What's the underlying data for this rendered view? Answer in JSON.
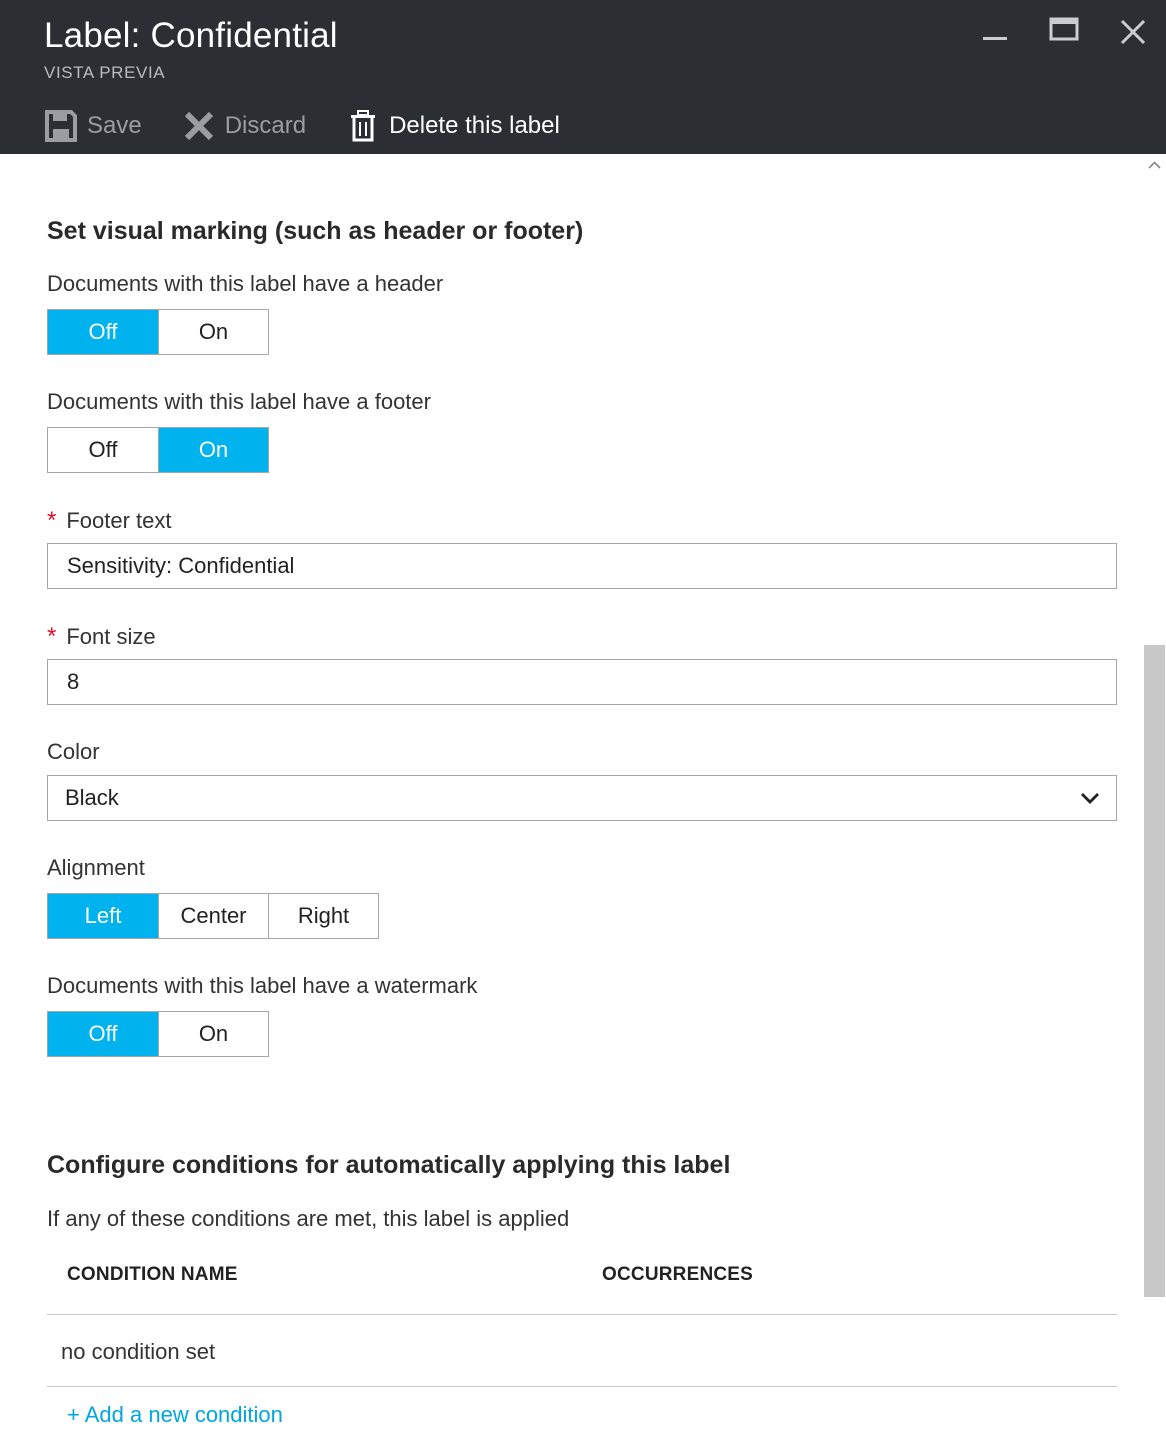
{
  "header": {
    "title": "Label: Confidential",
    "subtitle": "VISTA PREVIA",
    "window_controls": [
      "minimize-icon",
      "maximize-icon",
      "close-icon"
    ]
  },
  "toolbar": {
    "save_label": "Save",
    "save_enabled": false,
    "discard_label": "Discard",
    "discard_enabled": false,
    "delete_label": "Delete this label",
    "delete_enabled": true
  },
  "visual_marking": {
    "title": "Set visual marking (such as header or footer)",
    "header_label": "Documents with this label have a header",
    "header_toggle": {
      "options": [
        "Off",
        "On"
      ],
      "selected": "Off"
    },
    "footer_label": "Documents with this label have a footer",
    "footer_toggle": {
      "options": [
        "Off",
        "On"
      ],
      "selected": "On"
    },
    "footer_text_label": "Footer text",
    "footer_text_required": "*",
    "footer_text_value": "Sensitivity: Confidential",
    "font_size_label": "Font size",
    "font_size_required": "*",
    "font_size_value": "8",
    "color_label": "Color",
    "color_value": "Black",
    "alignment_label": "Alignment",
    "alignment": {
      "options": [
        "Left",
        "Center",
        "Right"
      ],
      "selected": "Left"
    },
    "watermark_label": "Documents with this label have a watermark",
    "watermark_toggle": {
      "options": [
        "Off",
        "On"
      ],
      "selected": "Off"
    }
  },
  "conditions": {
    "title": "Configure conditions for automatically applying this label",
    "description": "If any of these conditions are met, this label is applied",
    "columns": [
      "CONDITION NAME",
      "OCCURRENCES"
    ],
    "empty_text": "no condition set",
    "add_link": "+ Add a new condition"
  },
  "colors": {
    "header_bg": "#2b2e33",
    "accent": "#00b3ef",
    "link": "#00a6e3",
    "required": "#e0102a"
  }
}
